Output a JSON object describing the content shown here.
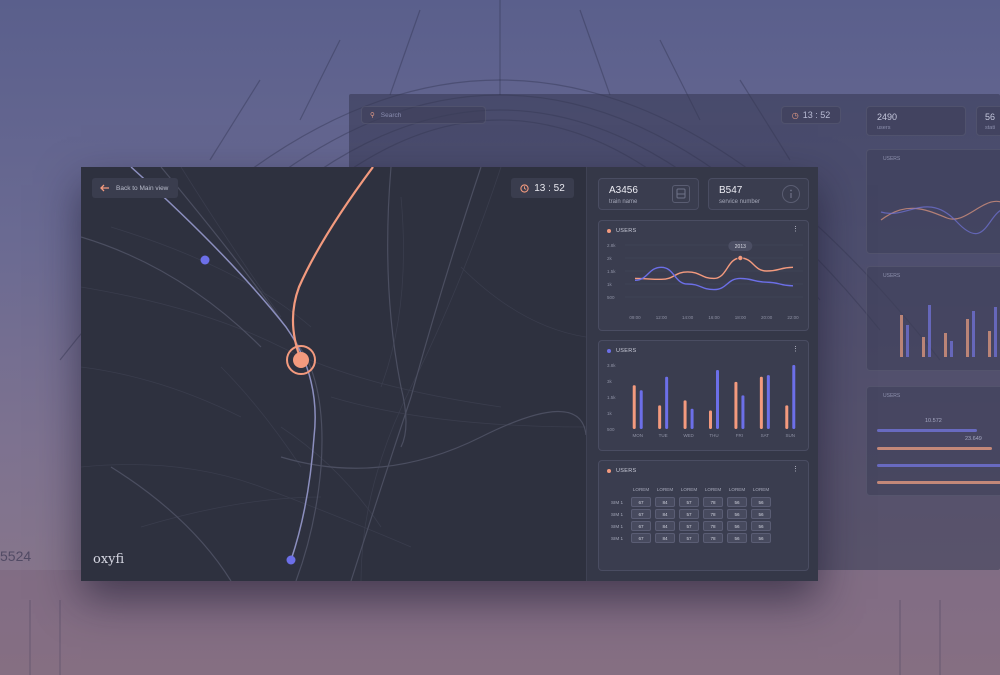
{
  "colors": {
    "accent_orange": "#f39a7e",
    "accent_blue": "#6c6fe8",
    "panel": "#2d303e"
  },
  "header": {
    "back_label": "Back to Main view",
    "back_icon": "arrow-left-icon",
    "clock_icon": "clock-icon",
    "time": "13 : 52"
  },
  "brand": {
    "logo": "oxyfi"
  },
  "info": [
    {
      "value": "A3456",
      "label": "train name",
      "icon": "train-icon"
    },
    {
      "value": "B547",
      "label": "service number",
      "icon": "info-icon"
    }
  ],
  "cards": {
    "line": {
      "title": "USERS",
      "tooltip": "2013"
    },
    "bars": {
      "title": "USERS"
    },
    "table": {
      "title": "USERS"
    }
  },
  "table": {
    "columns": [
      "LOREM",
      "LOREM",
      "LOREM",
      "LOREM",
      "LOREM",
      "LOREM"
    ],
    "rows": [
      {
        "label": "SIM 1",
        "cells": [
          "67",
          "84",
          "57",
          "78",
          "56",
          "56"
        ]
      },
      {
        "label": "SIM 1",
        "cells": [
          "67",
          "84",
          "57",
          "78",
          "56",
          "56"
        ]
      },
      {
        "label": "SIM 1",
        "cells": [
          "67",
          "84",
          "57",
          "78",
          "56",
          "56"
        ]
      },
      {
        "label": "SIM 1",
        "cells": [
          "67",
          "84",
          "57",
          "78",
          "56",
          "56"
        ]
      }
    ]
  },
  "ghost": {
    "search_placeholder": "Search",
    "time": "13 : 52",
    "stat1_value": "2490",
    "stat1_label": "users",
    "stat2_value": "56",
    "stat2_label": "stati",
    "users_label": "USERS",
    "progress_a": "10.572",
    "progress_b": "23.649",
    "station_number": "5524"
  },
  "chart_data": [
    {
      "type": "line",
      "title": "USERS",
      "x": [
        "09:00",
        "12:00",
        "14:00",
        "16:00",
        "18:00",
        "20:00",
        "22:00"
      ],
      "y_ticks": [
        "2.8k",
        "2k",
        "1.5k",
        "1k",
        "500"
      ],
      "series": [
        {
          "color": "#f39a7e",
          "values": [
            1.0,
            0.95,
            1.35,
            1.0,
            2.1,
            1.4,
            1.6
          ]
        },
        {
          "color": "#6c6fe8",
          "values": [
            0.9,
            1.6,
            0.7,
            0.4,
            1.0,
            0.8,
            0.6
          ]
        }
      ],
      "annotation": "2013"
    },
    {
      "type": "bar",
      "title": "USERS",
      "categories": [
        "MON",
        "TUE",
        "WED",
        "THU",
        "FRI",
        "SAT",
        "SUN"
      ],
      "y_ticks": [
        "3.8k",
        "3k",
        "1.5k",
        "1k",
        "500"
      ],
      "series": [
        {
          "color": "#f39a7e",
          "values": [
            2.6,
            1.4,
            1.7,
            1.1,
            2.8,
            3.1,
            1.4
          ]
        },
        {
          "color": "#6c6fe8",
          "values": [
            2.3,
            3.1,
            1.2,
            3.5,
            2.0,
            3.2,
            3.8
          ]
        }
      ]
    }
  ]
}
